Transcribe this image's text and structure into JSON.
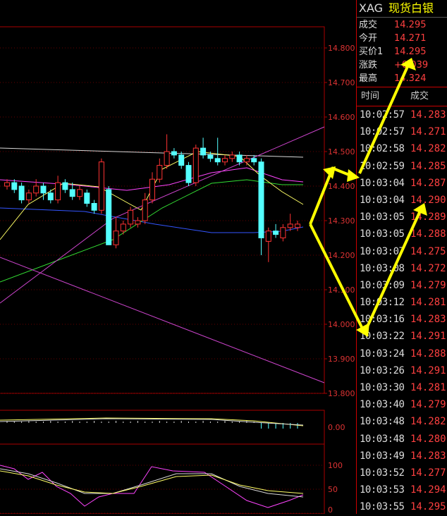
{
  "header": {
    "code": "XAG",
    "name": "现货白银"
  },
  "quotes": [
    {
      "label": "成交",
      "value": "14.295"
    },
    {
      "label": "今开",
      "value": "14.271"
    },
    {
      "label": "买价1",
      "value": "14.295"
    },
    {
      "label": "涨跌",
      "value": "+0.039"
    },
    {
      "label": "最高",
      "value": "14.324"
    }
  ],
  "ticks_header": {
    "time": "时间",
    "price": "成交"
  },
  "ticks": [
    {
      "time": "10:02:57",
      "price": "14.283"
    },
    {
      "time": "10:02:57",
      "price": "14.271"
    },
    {
      "time": "10:02:58",
      "price": "14.282"
    },
    {
      "time": "10:02:59",
      "price": "14.285"
    },
    {
      "time": "10:03:04",
      "price": "14.287"
    },
    {
      "time": "10:03:04",
      "price": "14.290"
    },
    {
      "time": "10:03:05",
      "price": "14.289"
    },
    {
      "time": "10:03:05",
      "price": "14.288"
    },
    {
      "time": "10:03:07",
      "price": "14.275"
    },
    {
      "time": "10:03:08",
      "price": "14.272"
    },
    {
      "time": "10:03:09",
      "price": "14.279"
    },
    {
      "time": "10:03:12",
      "price": "14.281"
    },
    {
      "time": "10:03:16",
      "price": "14.283"
    },
    {
      "time": "10:03:22",
      "price": "14.291"
    },
    {
      "time": "10:03:24",
      "price": "14.288"
    },
    {
      "time": "10:03:26",
      "price": "14.291"
    },
    {
      "time": "10:03:30",
      "price": "14.281"
    },
    {
      "time": "10:03:40",
      "price": "14.279"
    },
    {
      "time": "10:03:48",
      "price": "14.282"
    },
    {
      "time": "10:03:48",
      "price": "14.280"
    },
    {
      "time": "10:03:49",
      "price": "14.283"
    },
    {
      "time": "10:03:52",
      "price": "14.277"
    },
    {
      "time": "10:03:53",
      "price": "14.294"
    },
    {
      "time": "10:03:55",
      "price": "14.295"
    }
  ],
  "chart_data": {
    "type": "candlestick",
    "price_axis": {
      "ticks": [
        "14.800",
        "14.700",
        "14.600",
        "14.500",
        "14.400",
        "14.300",
        "14.200",
        "14.100",
        "14.000",
        "13.900",
        "13.800"
      ],
      "range": [
        13.8,
        14.8
      ]
    },
    "sub_axis1": {
      "ticks": [
        "0.00"
      ]
    },
    "sub_axis2": {
      "ticks": [
        "100",
        "50",
        "0"
      ],
      "range": [
        0,
        100
      ]
    },
    "candles": [
      {
        "o": 14.4,
        "c": 14.41,
        "h": 14.42,
        "l": 14.39
      },
      {
        "o": 14.41,
        "c": 14.39,
        "h": 14.42,
        "l": 14.38
      },
      {
        "o": 14.4,
        "c": 14.36,
        "h": 14.41,
        "l": 14.35
      },
      {
        "o": 14.36,
        "c": 14.38,
        "h": 14.39,
        "l": 14.35
      },
      {
        "o": 14.38,
        "c": 14.4,
        "h": 14.42,
        "l": 14.37
      },
      {
        "o": 14.4,
        "c": 14.38,
        "h": 14.41,
        "l": 14.36
      },
      {
        "o": 14.38,
        "c": 14.36,
        "h": 14.39,
        "l": 14.35
      },
      {
        "o": 14.36,
        "c": 14.41,
        "h": 14.43,
        "l": 14.35
      },
      {
        "o": 14.41,
        "c": 14.39,
        "h": 14.42,
        "l": 14.38
      },
      {
        "o": 14.39,
        "c": 14.37,
        "h": 14.41,
        "l": 14.36
      },
      {
        "o": 14.37,
        "c": 14.39,
        "h": 14.4,
        "l": 14.36
      },
      {
        "o": 14.38,
        "c": 14.35,
        "h": 14.39,
        "l": 14.34
      },
      {
        "o": 14.35,
        "c": 14.33,
        "h": 14.36,
        "l": 14.32
      },
      {
        "o": 14.33,
        "c": 14.47,
        "h": 14.48,
        "l": 14.32
      },
      {
        "o": 14.39,
        "c": 14.23,
        "h": 14.4,
        "l": 14.23
      },
      {
        "o": 14.23,
        "c": 14.27,
        "h": 14.31,
        "l": 14.22
      },
      {
        "o": 14.27,
        "c": 14.29,
        "h": 14.3,
        "l": 14.26
      },
      {
        "o": 14.29,
        "c": 14.33,
        "h": 14.34,
        "l": 14.28
      },
      {
        "o": 14.29,
        "c": 14.3,
        "h": 14.31,
        "l": 14.28
      },
      {
        "o": 14.3,
        "c": 14.36,
        "h": 14.38,
        "l": 14.29
      },
      {
        "o": 14.36,
        "c": 14.42,
        "h": 14.44,
        "l": 14.35
      },
      {
        "o": 14.42,
        "c": 14.46,
        "h": 14.48,
        "l": 14.41
      },
      {
        "o": 14.46,
        "c": 14.5,
        "h": 14.55,
        "l": 14.45
      },
      {
        "o": 14.5,
        "c": 14.49,
        "h": 14.51,
        "l": 14.48
      },
      {
        "o": 14.49,
        "c": 14.46,
        "h": 14.5,
        "l": 14.45
      },
      {
        "o": 14.46,
        "c": 14.41,
        "h": 14.47,
        "l": 14.4
      },
      {
        "o": 14.41,
        "c": 14.51,
        "h": 14.52,
        "l": 14.4
      },
      {
        "o": 14.51,
        "c": 14.49,
        "h": 14.54,
        "l": 14.48
      },
      {
        "o": 14.49,
        "c": 14.48,
        "h": 14.5,
        "l": 14.47
      },
      {
        "o": 14.48,
        "c": 14.47,
        "h": 14.54,
        "l": 14.46
      },
      {
        "o": 14.47,
        "c": 14.48,
        "h": 14.49,
        "l": 14.46
      },
      {
        "o": 14.48,
        "c": 14.49,
        "h": 14.5,
        "l": 14.47
      },
      {
        "o": 14.49,
        "c": 14.47,
        "h": 14.5,
        "l": 14.46
      },
      {
        "o": 14.47,
        "c": 14.48,
        "h": 14.49,
        "l": 14.46
      },
      {
        "o": 14.48,
        "c": 14.47,
        "h": 14.49,
        "l": 14.46
      },
      {
        "o": 14.47,
        "c": 14.25,
        "h": 14.48,
        "l": 14.2
      },
      {
        "o": 14.24,
        "c": 14.27,
        "h": 14.28,
        "l": 14.18
      },
      {
        "o": 14.27,
        "c": 14.26,
        "h": 14.29,
        "l": 14.25
      },
      {
        "o": 14.25,
        "c": 14.28,
        "h": 14.29,
        "l": 14.24
      },
      {
        "o": 14.28,
        "c": 14.29,
        "h": 14.32,
        "l": 14.27
      },
      {
        "o": 14.28,
        "c": 14.29,
        "h": 14.3,
        "l": 14.27
      }
    ],
    "series": [],
    "grid": false
  },
  "colors": {
    "up": "#ff3333",
    "down": "#54ffff",
    "ma_white": "#d8d8d8",
    "ma_yellow": "#ffff66",
    "ma_magenta": "#ff44ff",
    "ma_green": "#33dd33",
    "ma_blue": "#3355ff",
    "trend": "#cc44cc",
    "annotation": "#ffff00"
  }
}
